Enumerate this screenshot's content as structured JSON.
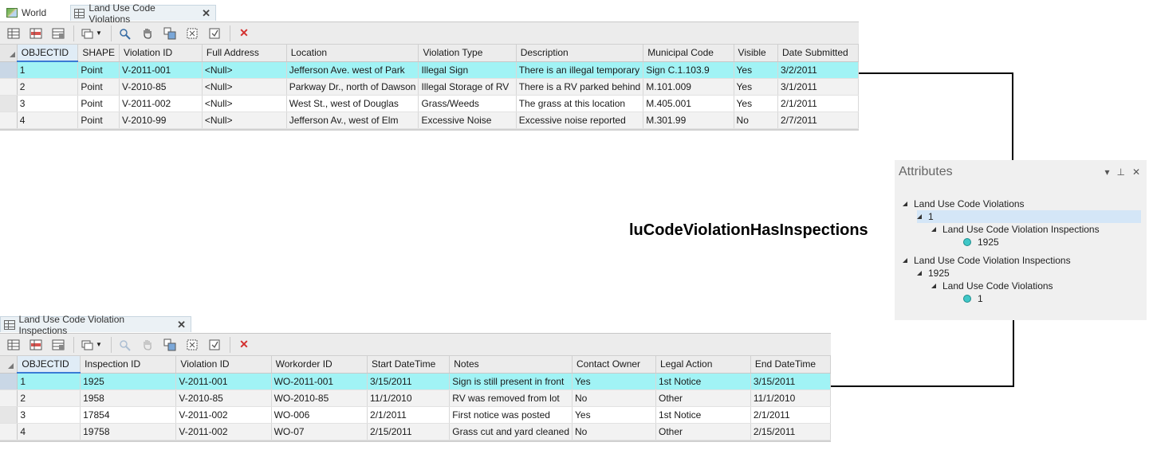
{
  "top": {
    "tabs": [
      {
        "label": "World",
        "icon": "world-map-icon",
        "active": false
      },
      {
        "label": "Land Use Code Violations",
        "icon": "table-icon",
        "active": true,
        "close": "✕"
      }
    ],
    "columns": [
      "OBJECTID",
      "SHAPE",
      "Violation ID",
      "Full Address",
      "Location",
      "Violation Type",
      "Description",
      "Municipal Code",
      "Visible",
      "Date Submitted"
    ],
    "rows": [
      [
        "1",
        "Point",
        "V-2011-001",
        "<Null>",
        "Jefferson Ave. west of Park",
        "Illegal Sign",
        "There is an illegal temporary",
        "Sign C.1.103.9",
        "Yes",
        "3/2/2011"
      ],
      [
        "2",
        "Point",
        "V-2010-85",
        "<Null>",
        "Parkway Dr., north of Dawson",
        "Illegal Storage of RV",
        "There is a RV parked behind",
        "M.101.009",
        "Yes",
        "3/1/2011"
      ],
      [
        "3",
        "Point",
        "V-2011-002",
        "<Null>",
        "West St., west of Douglas",
        "Grass/Weeds",
        "The grass at this location",
        "M.405.001",
        "Yes",
        "2/1/2011"
      ],
      [
        "4",
        "Point",
        "V-2010-99",
        "<Null>",
        "Jefferson Av., west of Elm",
        "Excessive Noise",
        "Excessive noise reported",
        "M.301.99",
        "No",
        "2/7/2011"
      ]
    ]
  },
  "bottom": {
    "tabs": [
      {
        "label": "Land Use Code Violation Inspections",
        "icon": "table-icon",
        "active": true,
        "close": "✕"
      }
    ],
    "columns": [
      "OBJECTID",
      "Inspection ID",
      "Violation ID",
      "Workorder ID",
      "Start DateTime",
      "Notes",
      "Contact Owner",
      "Legal Action",
      "End DateTime"
    ],
    "rows": [
      [
        "1",
        "1925",
        "V-2011-001",
        "WO-2011-001",
        "3/15/2011",
        "Sign is still present in front",
        "Yes",
        "1st Notice",
        "3/15/2011"
      ],
      [
        "2",
        "1958",
        "V-2010-85",
        "WO-2010-85",
        "11/1/2010",
        "RV was removed from lot",
        "No",
        "Other",
        "11/1/2010"
      ],
      [
        "3",
        "17854",
        "V-2011-002",
        "WO-006",
        "2/1/2011",
        "First notice was posted",
        "Yes",
        "1st Notice",
        "2/1/2011"
      ],
      [
        "4",
        "19758",
        "V-2011-002",
        "WO-07",
        "2/15/2011",
        "Grass cut and yard cleaned",
        "No",
        "Other",
        "2/15/2011"
      ]
    ]
  },
  "relationship_label": "luCodeViolationHasInspections",
  "attributes_pane": {
    "title": "Attributes",
    "controls": {
      "dropdown": "▾",
      "pin": "⊥",
      "close": "✕"
    },
    "tree": [
      {
        "label": "Land Use Code Violations",
        "level": 0,
        "icon": "expand-triangle-icon"
      },
      {
        "label": "1",
        "level": 1,
        "icon": "expand-triangle-icon",
        "selected": true
      },
      {
        "label": "Land Use Code Violation Inspections",
        "level": 2,
        "icon": "expand-triangle-icon"
      },
      {
        "label": "1925",
        "level": 3,
        "icon": "point-feature-icon"
      },
      {
        "label": "Land Use Code Violation Inspections",
        "level": 0,
        "icon": "expand-triangle-icon"
      },
      {
        "label": "1925",
        "level": 1,
        "icon": "expand-triangle-icon"
      },
      {
        "label": "Land Use Code Violations",
        "level": 2,
        "icon": "expand-triangle-icon"
      },
      {
        "label": "1",
        "level": 3,
        "icon": "point-feature-icon"
      }
    ]
  },
  "colors": {
    "selected_row": "#a1f3f5",
    "delete_red": "#d3302f",
    "selection_tree": "#d4e6f7"
  }
}
